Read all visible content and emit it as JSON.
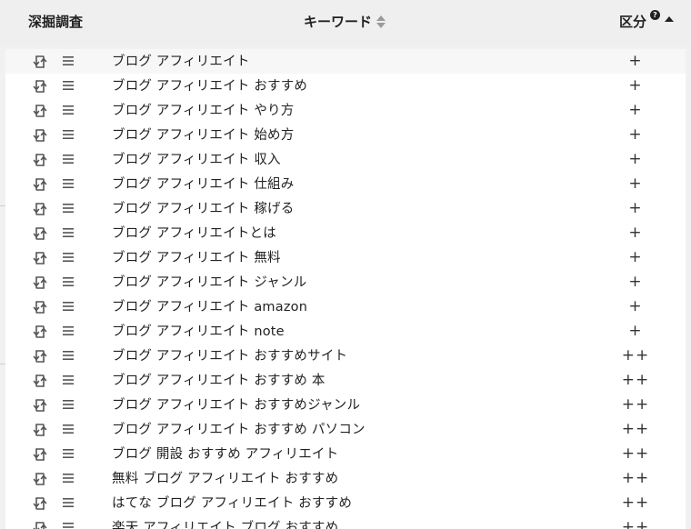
{
  "header": {
    "deep_dive_label": "深掘調査",
    "keyword_label": "キーワード",
    "kubun_label": "区分",
    "help_glyph": "?"
  },
  "rows": [
    {
      "keyword": "ブログ アフィリエイト",
      "kubun": "+"
    },
    {
      "keyword": "ブログ アフィリエイト おすすめ",
      "kubun": "+"
    },
    {
      "keyword": "ブログ アフィリエイト やり方",
      "kubun": "+"
    },
    {
      "keyword": "ブログ アフィリエイト 始め方",
      "kubun": "+"
    },
    {
      "keyword": "ブログ アフィリエイト 収入",
      "kubun": "+"
    },
    {
      "keyword": "ブログ アフィリエイト 仕組み",
      "kubun": "+"
    },
    {
      "keyword": "ブログ アフィリエイト 稼げる",
      "kubun": "+"
    },
    {
      "keyword": "ブログ アフィリエイトとは",
      "kubun": "+"
    },
    {
      "keyword": "ブログ アフィリエイト 無料",
      "kubun": "+"
    },
    {
      "keyword": "ブログ アフィリエイト ジャンル",
      "kubun": "+"
    },
    {
      "keyword": "ブログ アフィリエイト amazon",
      "kubun": "+"
    },
    {
      "keyword": "ブログ アフィリエイト note",
      "kubun": "+"
    },
    {
      "keyword": "ブログ アフィリエイト おすすめサイト",
      "kubun": "++"
    },
    {
      "keyword": "ブログ アフィリエイト おすすめ 本",
      "kubun": "++"
    },
    {
      "keyword": "ブログ アフィリエイト おすすめジャンル",
      "kubun": "++"
    },
    {
      "keyword": "ブログ アフィリエイト おすすめ パソコン",
      "kubun": "++"
    },
    {
      "keyword": "ブログ 開設 おすすめ アフィリエイト",
      "kubun": "++"
    },
    {
      "keyword": "無料 ブログ アフィリエイト おすすめ",
      "kubun": "++"
    },
    {
      "keyword": "はてな ブログ アフィリエイト おすすめ",
      "kubun": "++"
    },
    {
      "keyword": "楽天 アフィリエイト ブログ おすすめ",
      "kubun": "++"
    }
  ],
  "icons": {
    "swap": "swap-icon",
    "menu": "menu-icon",
    "help": "help-icon",
    "sort_both": "sort-both-icon",
    "sort_up": "sort-up-icon"
  }
}
